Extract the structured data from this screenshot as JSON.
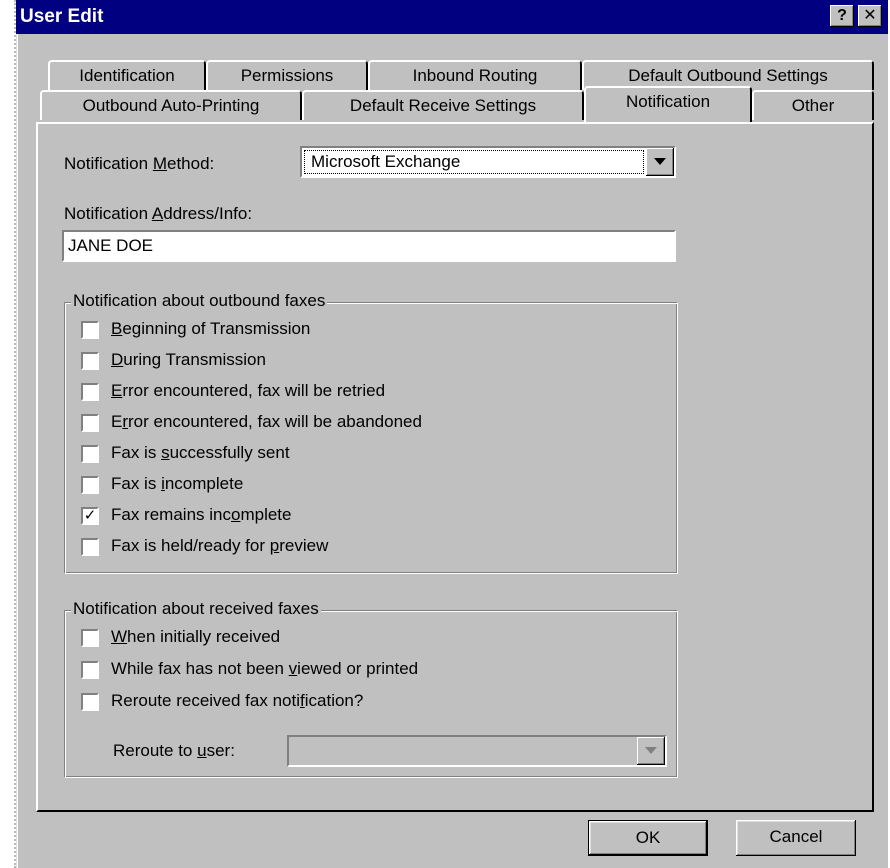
{
  "window": {
    "title": "User Edit",
    "help_glyph": "?",
    "close_glyph": "✕"
  },
  "tabs_row1": [
    "Identification",
    "Permissions",
    "Inbound Routing",
    "Default Outbound Settings"
  ],
  "tabs_row2": [
    "Outbound Auto-Printing",
    "Default Receive Settings",
    "Notification",
    "Other"
  ],
  "active_tab": "Notification",
  "notification": {
    "method_label_pre": "Notification ",
    "method_label_u": "M",
    "method_label_post": "ethod:",
    "method_value": "Microsoft Exchange",
    "address_label_pre": "Notification ",
    "address_label_u": "A",
    "address_label_post": "ddress/Info:",
    "address_value": "JANE DOE"
  },
  "outbound_group": {
    "title": "Notification about outbound faxes",
    "items": [
      {
        "pre": "",
        "u": "B",
        "post": "eginning of Transmission",
        "checked": false
      },
      {
        "pre": "",
        "u": "D",
        "post": "uring Transmission",
        "checked": false
      },
      {
        "pre": "",
        "u": "E",
        "post": "rror encountered, fax will be retried",
        "checked": false
      },
      {
        "pre": "E",
        "u": "r",
        "post": "ror encountered, fax will be abandoned",
        "checked": false
      },
      {
        "pre": "Fax is ",
        "u": "s",
        "post": "uccessfully sent",
        "checked": false
      },
      {
        "pre": "Fax is ",
        "u": "i",
        "post": "ncomplete",
        "checked": false
      },
      {
        "pre": "Fax remains inc",
        "u": "o",
        "post": "mplete",
        "checked": true
      },
      {
        "pre": "Fax is held/ready for ",
        "u": "p",
        "post": "review",
        "checked": false
      }
    ]
  },
  "received_group": {
    "title": "Notification about received faxes",
    "items": [
      {
        "pre": "",
        "u": "W",
        "post": "hen initially received",
        "checked": false
      },
      {
        "pre": "While fax has not been ",
        "u": "v",
        "post": "iewed or printed",
        "checked": false
      },
      {
        "pre": "Reroute received fax noti",
        "u": "f",
        "post": "ication?",
        "checked": false
      }
    ],
    "reroute_label_pre": "Reroute to ",
    "reroute_label_u": "u",
    "reroute_label_post": "ser:",
    "reroute_value": ""
  },
  "buttons": {
    "ok": "OK",
    "cancel": "Cancel"
  },
  "check_glyph": "✓",
  "icons": {
    "help": "help-icon",
    "close": "close-icon",
    "dropdown": "chevron-down-icon"
  }
}
